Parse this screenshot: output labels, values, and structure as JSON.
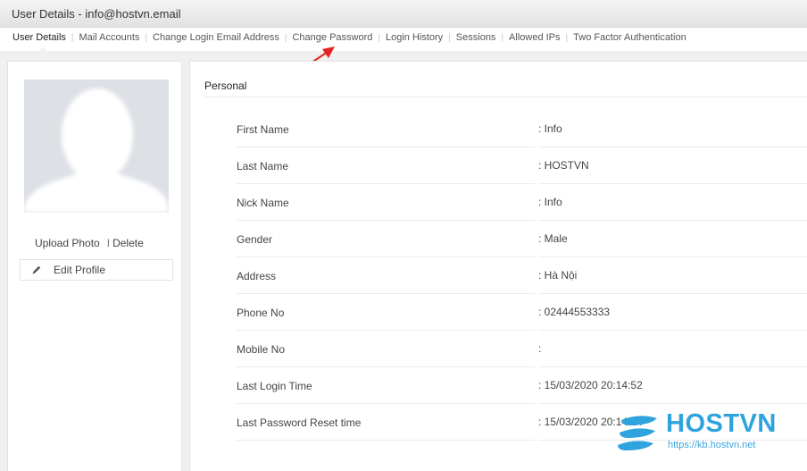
{
  "window": {
    "title": "User Details - info@hostvn.email"
  },
  "tabs": [
    {
      "label": "User Details",
      "active": true
    },
    {
      "label": "Mail Accounts"
    },
    {
      "label": "Change Login Email Address"
    },
    {
      "label": "Change Password"
    },
    {
      "label": "Login History"
    },
    {
      "label": "Sessions"
    },
    {
      "label": "Allowed IPs"
    },
    {
      "label": "Two Factor Authentication"
    }
  ],
  "profile": {
    "upload_label": "Upload Photo",
    "delete_label": "Delete",
    "edit_label": "Edit Profile"
  },
  "personal": {
    "title": "Personal",
    "fields": [
      {
        "label": "First Name",
        "value": ": Info"
      },
      {
        "label": "Last Name",
        "value": ": HOSTVN"
      },
      {
        "label": "Nick Name",
        "value": ": Info"
      },
      {
        "label": "Gender",
        "value": ": Male"
      },
      {
        "label": "Address",
        "value": ": Hà Nội"
      },
      {
        "label": "Phone No",
        "value": ": 02444553333"
      },
      {
        "label": "Mobile No",
        "value": ":"
      },
      {
        "label": "Last Login Time",
        "value": ": 15/03/2020 20:14:52"
      },
      {
        "label": "Last Password Reset time",
        "value": ": 15/03/2020 20:14:24"
      }
    ]
  },
  "watermark": {
    "brand": "HOSTVN",
    "url": "https://kb.hostvn.net"
  },
  "colors": {
    "accent": "#2ea3dd",
    "arrow": "#e02424",
    "avatar_bg": "#dde0e5"
  }
}
